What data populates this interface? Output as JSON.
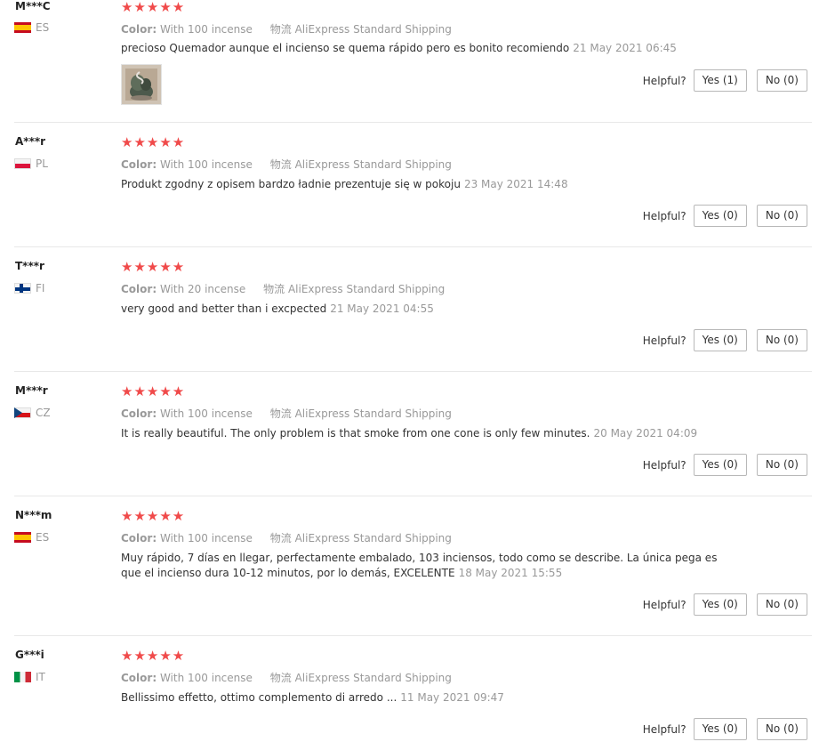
{
  "labels": {
    "color_label": "Color:",
    "shipping_prefix": "物流",
    "helpful_label": "Helpful?",
    "stars": "★★★★★"
  },
  "reviews": [
    {
      "user": "M***C",
      "country": "ES",
      "flag": "es",
      "color": "With 100 incense",
      "shipping": "AliExpress Standard Shipping",
      "text": "precioso Quemador aunque el incienso se quema rápido pero es bonito recomiendo",
      "date": "21 May 2021 06:45",
      "has_photo": true,
      "yes": "Yes (1)",
      "no": "No (0)"
    },
    {
      "user": "A***r",
      "country": "PL",
      "flag": "pl",
      "color": "With 100 incense",
      "shipping": "AliExpress Standard Shipping",
      "text": "Produkt zgodny z opisem bardzo ładnie prezentuje się w pokoju",
      "date": "23 May 2021 14:48",
      "yes": "Yes (0)",
      "no": "No (0)"
    },
    {
      "user": "T***r",
      "country": "FI",
      "flag": "fi",
      "color": "With 20 incense",
      "shipping": "AliExpress Standard Shipping",
      "text": "very good and better than i excpected",
      "date": "21 May 2021 04:55",
      "yes": "Yes (0)",
      "no": "No (0)"
    },
    {
      "user": "M***r",
      "country": "CZ",
      "flag": "cz",
      "color": "With 100 incense",
      "shipping": "AliExpress Standard Shipping",
      "text": "It is really beautiful. The only problem is that smoke from one cone is only few minutes.",
      "date": "20 May 2021 04:09",
      "yes": "Yes (0)",
      "no": "No (0)"
    },
    {
      "user": "N***m",
      "country": "ES",
      "flag": "es",
      "color": "With 100 incense",
      "shipping": "AliExpress Standard Shipping",
      "text": "Muy rápido, 7 días en llegar, perfectamente embalado, 103 inciensos, todo como se describe. La única pega es que el incienso dura 10-12 minutos, por lo demás, EXCELENTE",
      "date": "18 May 2021 15:55",
      "yes": "Yes (0)",
      "no": "No (0)"
    },
    {
      "user": "G***i",
      "country": "IT",
      "flag": "it",
      "color": "With 100 incense",
      "shipping": "AliExpress Standard Shipping",
      "text": "Bellissimo effetto, ottimo complemento di arredo ...",
      "date": "11 May 2021 09:47",
      "yes": "Yes (0)",
      "no": "No (0)"
    }
  ]
}
